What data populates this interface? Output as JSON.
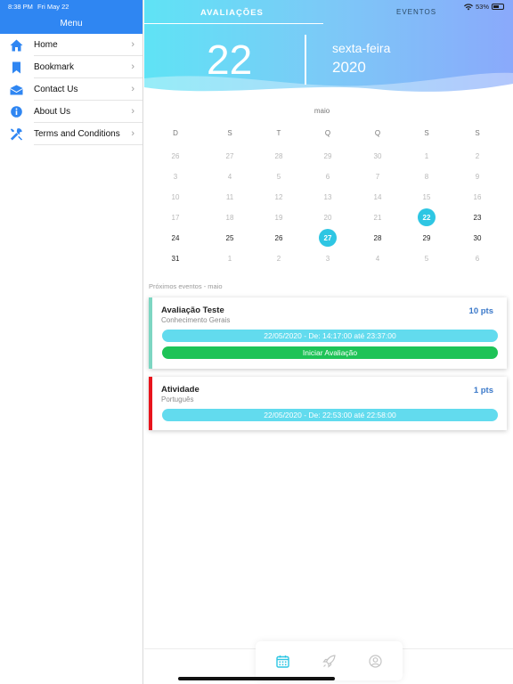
{
  "status": {
    "time": "8:38 PM",
    "date": "Fri May 22",
    "battery": "53%"
  },
  "sidebar": {
    "title": "Menu",
    "items": [
      {
        "label": "Home",
        "icon": "home-icon"
      },
      {
        "label": "Bookmark",
        "icon": "bookmark-icon"
      },
      {
        "label": "Contact Us",
        "icon": "envelope-icon"
      },
      {
        "label": "About Us",
        "icon": "info-icon"
      },
      {
        "label": "Terms and Conditions",
        "icon": "tools-icon"
      }
    ]
  },
  "tabs": {
    "active": "AVALIAÇÕES",
    "other": "EVENTOS"
  },
  "header": {
    "day": "22",
    "weekday": "sexta-feira",
    "year": "2020"
  },
  "calendar": {
    "month": "maio",
    "weekdays": [
      "D",
      "S",
      "T",
      "Q",
      "Q",
      "S",
      "S"
    ],
    "weeks": [
      [
        "26",
        "27",
        "28",
        "29",
        "30",
        "1",
        "2"
      ],
      [
        "3",
        "4",
        "5",
        "6",
        "7",
        "8",
        "9"
      ],
      [
        "10",
        "11",
        "12",
        "13",
        "14",
        "15",
        "16"
      ],
      [
        "17",
        "18",
        "19",
        "20",
        "21",
        "22",
        "23"
      ],
      [
        "24",
        "25",
        "26",
        "27",
        "28",
        "29",
        "30"
      ],
      [
        "31",
        "1",
        "2",
        "3",
        "4",
        "5",
        "6"
      ]
    ]
  },
  "events_label": "Próximos eventos - maio",
  "cards": [
    {
      "title": "Avaliação Teste",
      "subtitle": "Conhecimento Gerais",
      "points": "10 pts",
      "schedule": "22/05/2020 - De: 14:17:00 até 23:37:00",
      "action": "Iniciar Avaliação",
      "accent": "#7dd6c2"
    },
    {
      "title": "Atividade",
      "subtitle": "Português",
      "points": "1 pts",
      "schedule": "22/05/2020 - De: 22:53:00 até 22:58:00",
      "accent": "#e8141c"
    }
  ],
  "bottom_tabs": [
    {
      "icon": "calendar-icon",
      "active": true
    },
    {
      "icon": "rocket-icon",
      "active": false
    },
    {
      "icon": "user-circle-icon",
      "active": false
    }
  ],
  "colors": {
    "accent": "#2f86f2",
    "cyan": "#62dbee",
    "green": "#1ec357",
    "selected": "#2ec6e3"
  }
}
